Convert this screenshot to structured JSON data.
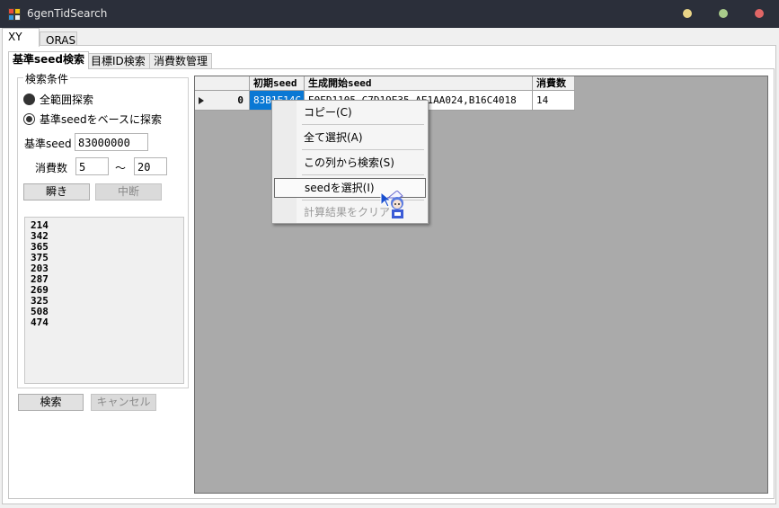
{
  "window": {
    "title": "6genTidSearch",
    "controls": [
      {
        "name": "minimize",
        "color": "#e9d487"
      },
      {
        "name": "maximize",
        "color": "#a9cc8b"
      },
      {
        "name": "close",
        "color": "#e06666"
      }
    ]
  },
  "outer_tabs": [
    "XY",
    "ORAS"
  ],
  "inner_tabs": [
    "基準seed検索",
    "目標ID検索",
    "消費数管理"
  ],
  "search_conditions": {
    "legend": "検索条件",
    "radio_full_range": "全範囲探索",
    "radio_base_seed": "基準seedをベースに探索",
    "base_seed_label": "基準seed",
    "base_seed_value": "83000000",
    "consumption_label": "消費数",
    "consumption_min": "5",
    "range_sep": "〜",
    "consumption_max": "20",
    "instant_button": "瞬き",
    "stop_button": "中断"
  },
  "result_list": [
    "214",
    "342",
    "365",
    "375",
    "203",
    "287",
    "269",
    "325",
    "508",
    "474"
  ],
  "bottom_buttons": {
    "search": "検索",
    "cancel": "キャンセル"
  },
  "grid": {
    "columns": [
      "初期seed",
      "生成開始seed",
      "消費数"
    ],
    "rows": [
      {
        "index": "0",
        "initial_seed": "83B1E14C",
        "start_seed": "E0ED1105,C7D19E35,AE1AA024,B16C4018",
        "consumption": "14"
      }
    ]
  },
  "context_menu": {
    "items": [
      "コピー(C)",
      "全て選択(A)",
      "この列から検索(S)",
      "seedを選択(I)",
      "計算結果をクリア"
    ]
  }
}
